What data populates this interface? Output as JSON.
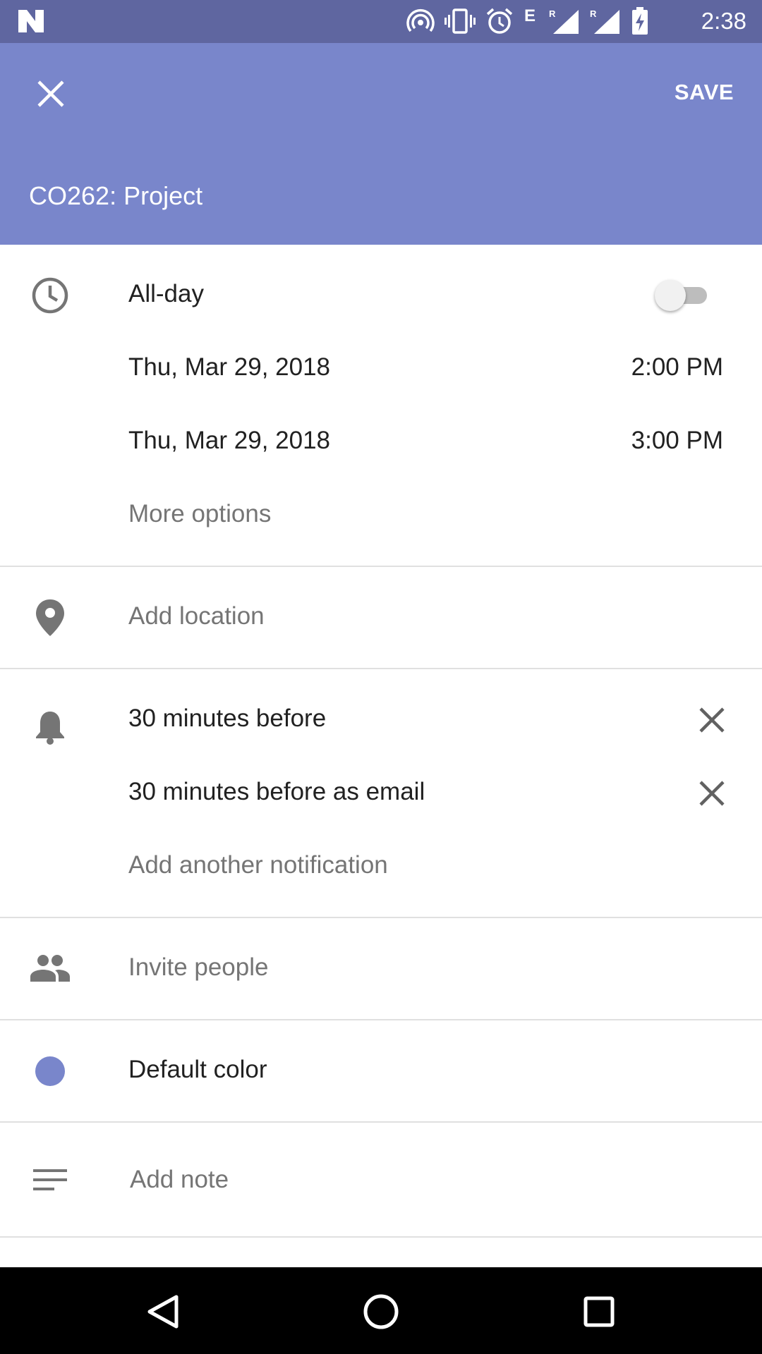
{
  "status_bar": {
    "time": "2:38",
    "icons": [
      "hotspot-icon",
      "vibrate-icon",
      "alarm-icon",
      "network-e-icon",
      "signal-roaming-icon",
      "signal-roaming-icon",
      "battery-charging-icon"
    ]
  },
  "app_bar": {
    "close_icon": "close-icon",
    "save_label": "SAVE",
    "title": "CO262: Project",
    "color": "#7986cb"
  },
  "time_section": {
    "all_day_label": "All-day",
    "all_day_enabled": false,
    "start_date": "Thu, Mar 29, 2018",
    "start_time": "2:00 PM",
    "end_date": "Thu, Mar 29, 2018",
    "end_time": "3:00 PM",
    "more_options": "More options"
  },
  "location": {
    "placeholder": "Add location"
  },
  "notifications": {
    "items": [
      {
        "label": "30 minutes before"
      },
      {
        "label": "30 minutes before as email"
      }
    ],
    "add_label": "Add another notification"
  },
  "invite": {
    "placeholder": "Invite people"
  },
  "color": {
    "label": "Default color",
    "value": "#7986cb"
  },
  "note": {
    "placeholder": "Add note"
  },
  "nav_bar": {
    "buttons": [
      "back-icon",
      "home-icon",
      "recents-icon"
    ]
  }
}
